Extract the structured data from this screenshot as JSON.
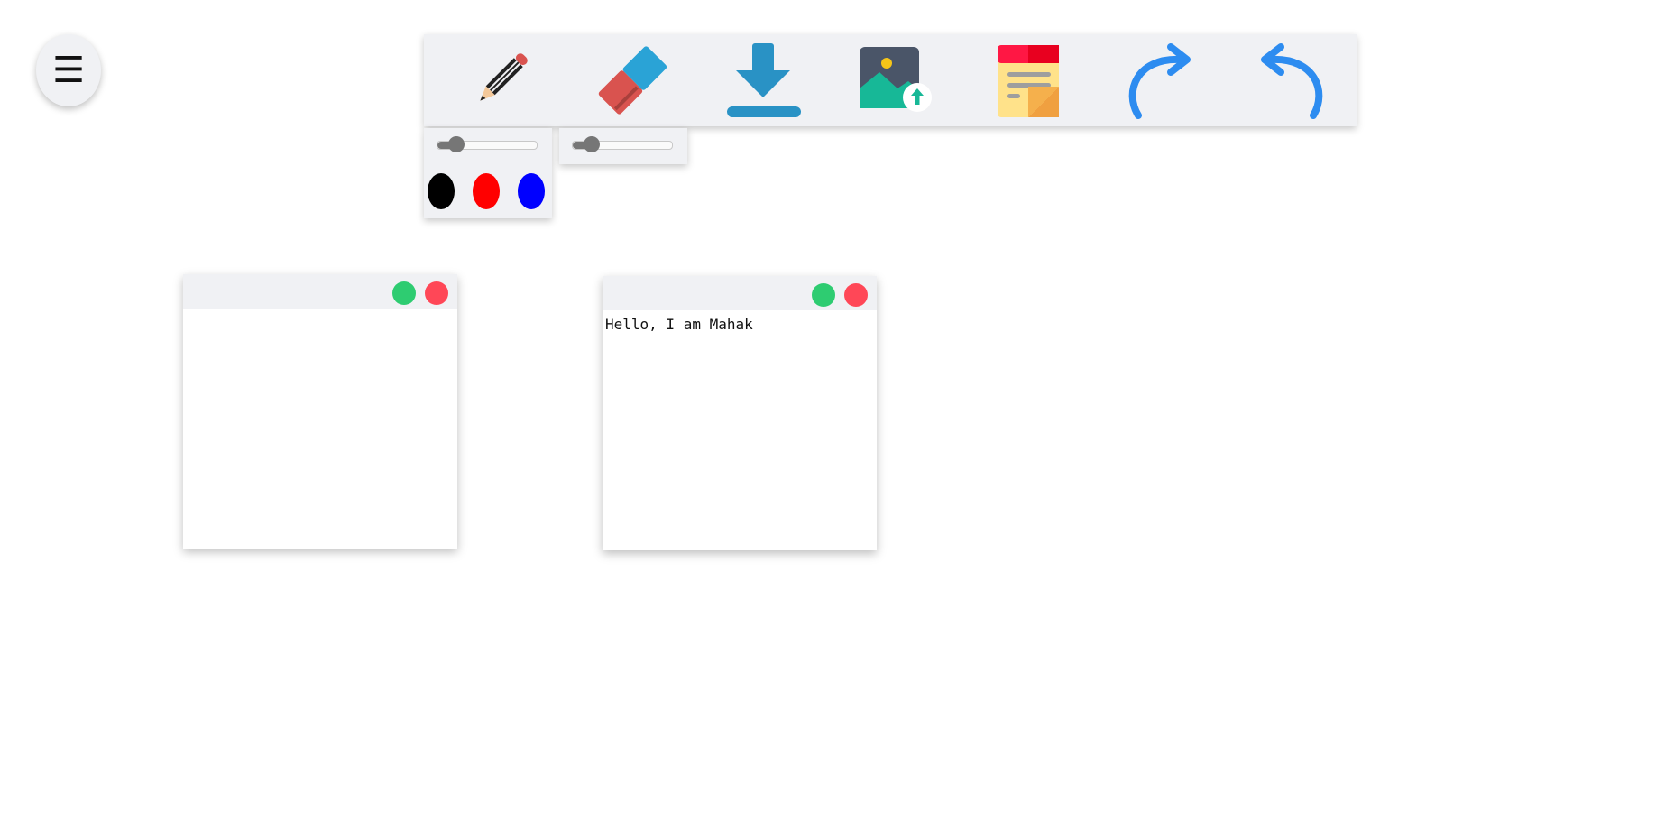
{
  "menu": {
    "icon": "hamburger-icon",
    "glyph": "☰"
  },
  "toolbar": {
    "tools": [
      {
        "name": "pencil",
        "icon": "pencil-icon"
      },
      {
        "name": "eraser",
        "icon": "eraser-icon"
      },
      {
        "name": "download",
        "icon": "download-icon"
      },
      {
        "name": "upload-image",
        "icon": "image-upload-icon"
      },
      {
        "name": "sticky-note",
        "icon": "sticky-note-icon"
      },
      {
        "name": "redo",
        "icon": "redo-icon"
      },
      {
        "name": "undo",
        "icon": "undo-icon"
      }
    ]
  },
  "pencil_options": {
    "size_value": 10,
    "colors": [
      "#000000",
      "#ff0000",
      "#0000ff"
    ]
  },
  "eraser_options": {
    "size_value": 10
  },
  "notes": [
    {
      "text": "",
      "minimize_color": "#2ecc71",
      "close_color": "#ff4757"
    },
    {
      "text": "Hello, I am Mahak",
      "minimize_color": "#2ecc71",
      "close_color": "#ff4757"
    }
  ]
}
